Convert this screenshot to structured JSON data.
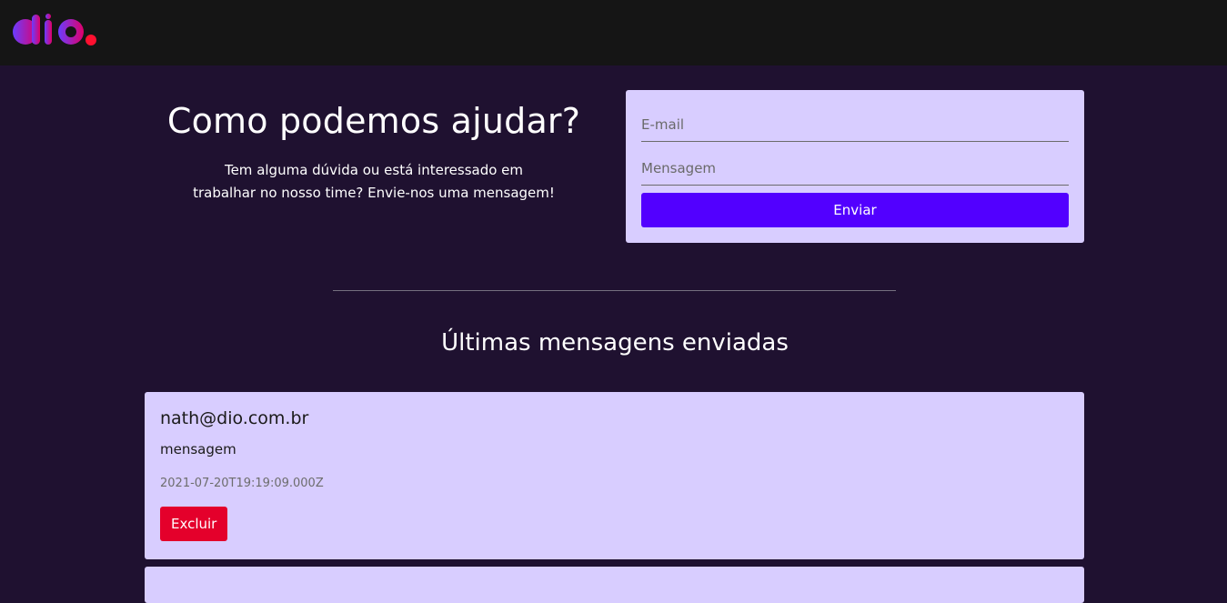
{
  "header": {
    "logo_text": "dio"
  },
  "hero": {
    "title": "Como podemos ajudar?",
    "description": "Tem alguma dúvida ou está interessado em trabalhar no nosso time? Envie-nos uma mensagem!"
  },
  "form": {
    "email_placeholder": "E-mail",
    "email_value": "",
    "message_placeholder": "Mensagem",
    "message_value": "",
    "send_label": "Enviar"
  },
  "messages": {
    "section_title": "Últimas mensagens enviadas",
    "items": [
      {
        "email": "nath@dio.com.br",
        "message": "mensagem",
        "date": "2021-07-20T19:19:09.000Z",
        "delete_label": "Excluir"
      }
    ]
  },
  "colors": {
    "header_bg": "#151515",
    "page_bg": "#1f1130",
    "card_bg": "#d8cdff",
    "primary": "#5200ff",
    "danger": "#e4002b"
  }
}
